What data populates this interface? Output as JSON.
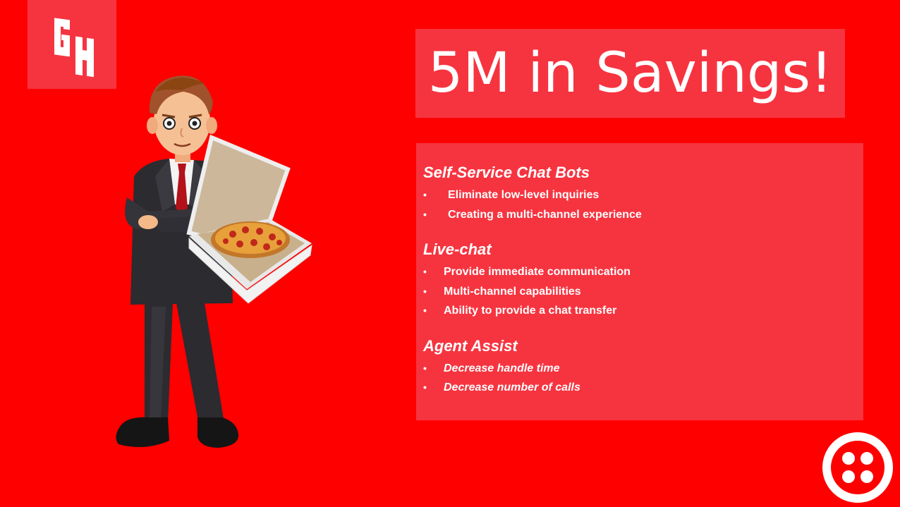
{
  "logo": {
    "text": "GH",
    "icon": "grubhub-logo"
  },
  "title": "5M in Savings!",
  "sections": [
    {
      "heading": "Self-Service Chat Bots",
      "items": [
        "Eliminate low-level inquiries",
        "Creating a multi-channel experience"
      ]
    },
    {
      "heading": "Live-chat",
      "items": [
        "Provide immediate communication",
        "Multi-channel capabilities",
        "Ability to provide a chat transfer"
      ]
    },
    {
      "heading": "Agent Assist",
      "items": [
        "Decrease handle time",
        "Decrease number of calls"
      ]
    }
  ],
  "bullet": "•",
  "illustration": "businessman-holding-pizza-box",
  "brand_logo": "twilio-logo",
  "colors": {
    "background": "#fe0000",
    "panel": "#f63440",
    "text": "#ffffff"
  }
}
